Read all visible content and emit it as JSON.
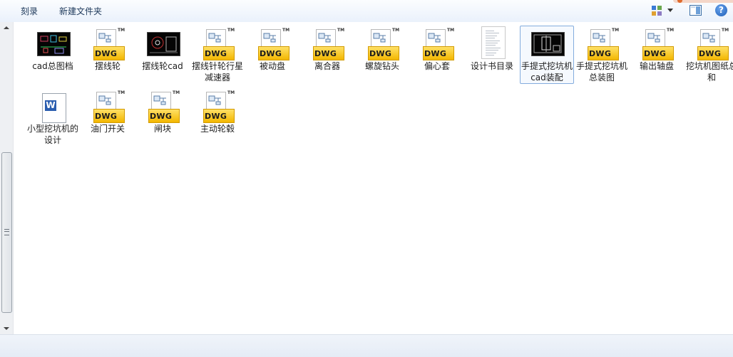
{
  "toolbar": {
    "burn_label": "刻录",
    "new_folder_label": "新建文件夹"
  },
  "files": [
    {
      "name": "cad总图档",
      "type": "cad-thumbnail"
    },
    {
      "name": "摆线轮",
      "type": "dwg"
    },
    {
      "name": "摆线轮cad",
      "type": "cad-thumbnail"
    },
    {
      "name": "摆线针轮行星减速器",
      "type": "dwg"
    },
    {
      "name": "被动盘",
      "type": "dwg"
    },
    {
      "name": "离合器",
      "type": "dwg"
    },
    {
      "name": "螺旋钻头",
      "type": "dwg"
    },
    {
      "name": "偏心套",
      "type": "dwg"
    },
    {
      "name": "设计书目录",
      "type": "text-document"
    },
    {
      "name": "手提式挖坑机cad装配",
      "type": "cad-thumbnail",
      "selected": true
    },
    {
      "name": "手提式挖坑机总装图",
      "type": "dwg"
    },
    {
      "name": "输出轴盘",
      "type": "dwg"
    },
    {
      "name": "挖坑机图纸总和",
      "type": "dwg"
    },
    {
      "name": "小型挖坑机的设计",
      "type": "word-document"
    },
    {
      "name": "油门开关",
      "type": "dwg"
    },
    {
      "name": "闸块",
      "type": "dwg"
    },
    {
      "name": "主动轮毂",
      "type": "dwg"
    }
  ],
  "icons": {
    "dwg_badge": "DWG",
    "trademark": "TM",
    "word_badge": "W",
    "help": "?"
  },
  "colors": {
    "dwg_yellow": "#f3b700",
    "selection_border": "#84acdd",
    "word_blue": "#2a5daf"
  }
}
